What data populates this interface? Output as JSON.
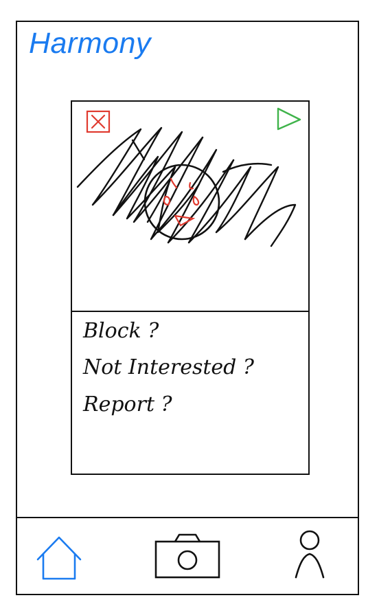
{
  "app": {
    "title": "Harmony"
  },
  "card": {
    "reject_icon": "x-icon",
    "like_icon": "play-triangle-icon",
    "photo_icon": "scribbled-face-icon"
  },
  "options": [
    {
      "label": "Block ?"
    },
    {
      "label": "Not Interested ?"
    },
    {
      "label": "Report ?"
    }
  ],
  "tabbar": {
    "home_icon": "home-icon",
    "camera_icon": "camera-icon",
    "profile_icon": "person-icon",
    "active_tab": "home"
  },
  "colors": {
    "accent": "#1a7bf0",
    "reject": "#e03a2f",
    "like": "#3fb34a",
    "ink": "#111111"
  }
}
